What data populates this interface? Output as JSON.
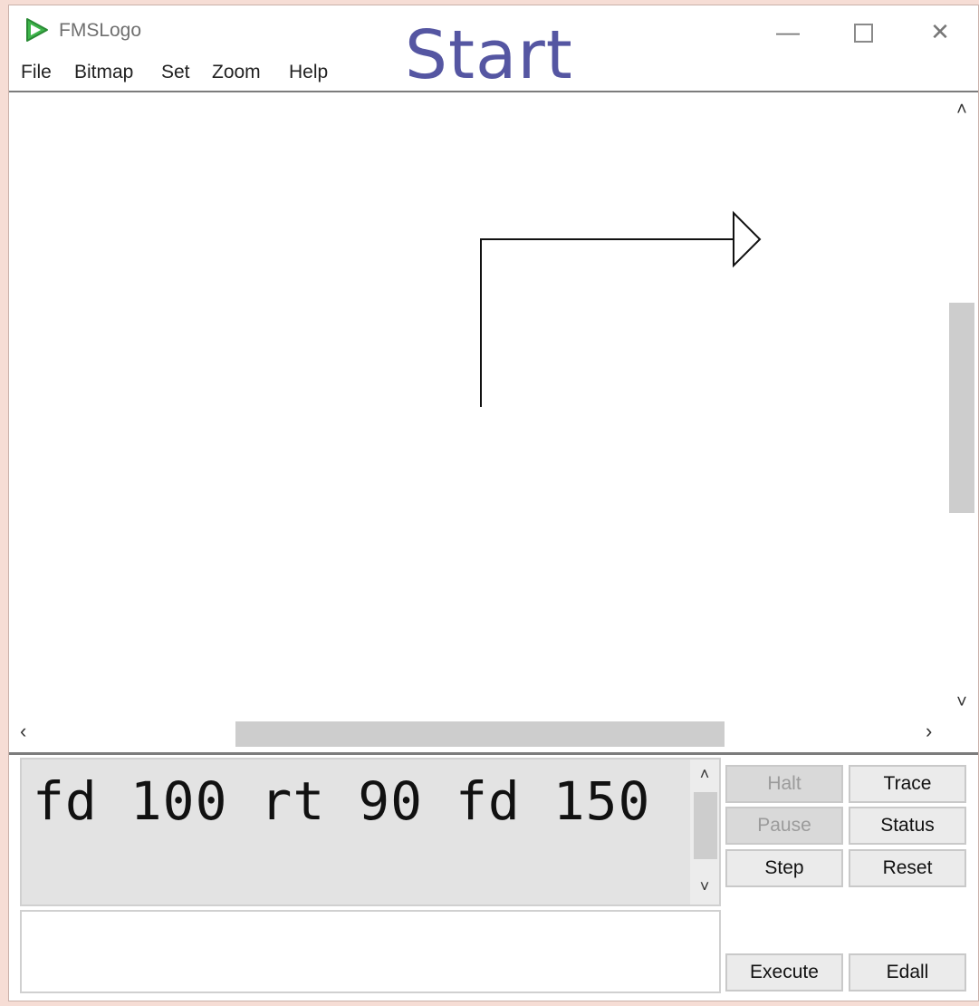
{
  "window": {
    "title": "FMSLogo",
    "controls": {
      "minimize": "—",
      "maximize": "",
      "close": "✕"
    }
  },
  "overlay_label": "Start",
  "menu": [
    "File",
    "Bitmap",
    "Set",
    "Zoom",
    "Help"
  ],
  "canvas": {
    "turtle_path": "fd 100 rt 90 fd 150",
    "scroll_glyphs": {
      "up": "˄",
      "down": "˅",
      "left": "‹",
      "right": "›"
    }
  },
  "commander": {
    "history_text": "fd 100 rt 90 fd 150",
    "input_value": "",
    "buttons": {
      "halt": "Halt",
      "trace": "Trace",
      "pause": "Pause",
      "status": "Status",
      "step": "Step",
      "reset": "Reset",
      "execute": "Execute",
      "edall": "Edall"
    }
  },
  "colors": {
    "background": "#f6ddd5",
    "overlay_text": "#5556a2",
    "app_icon": "#3db54a",
    "history_bg": "#e3e3e3"
  }
}
